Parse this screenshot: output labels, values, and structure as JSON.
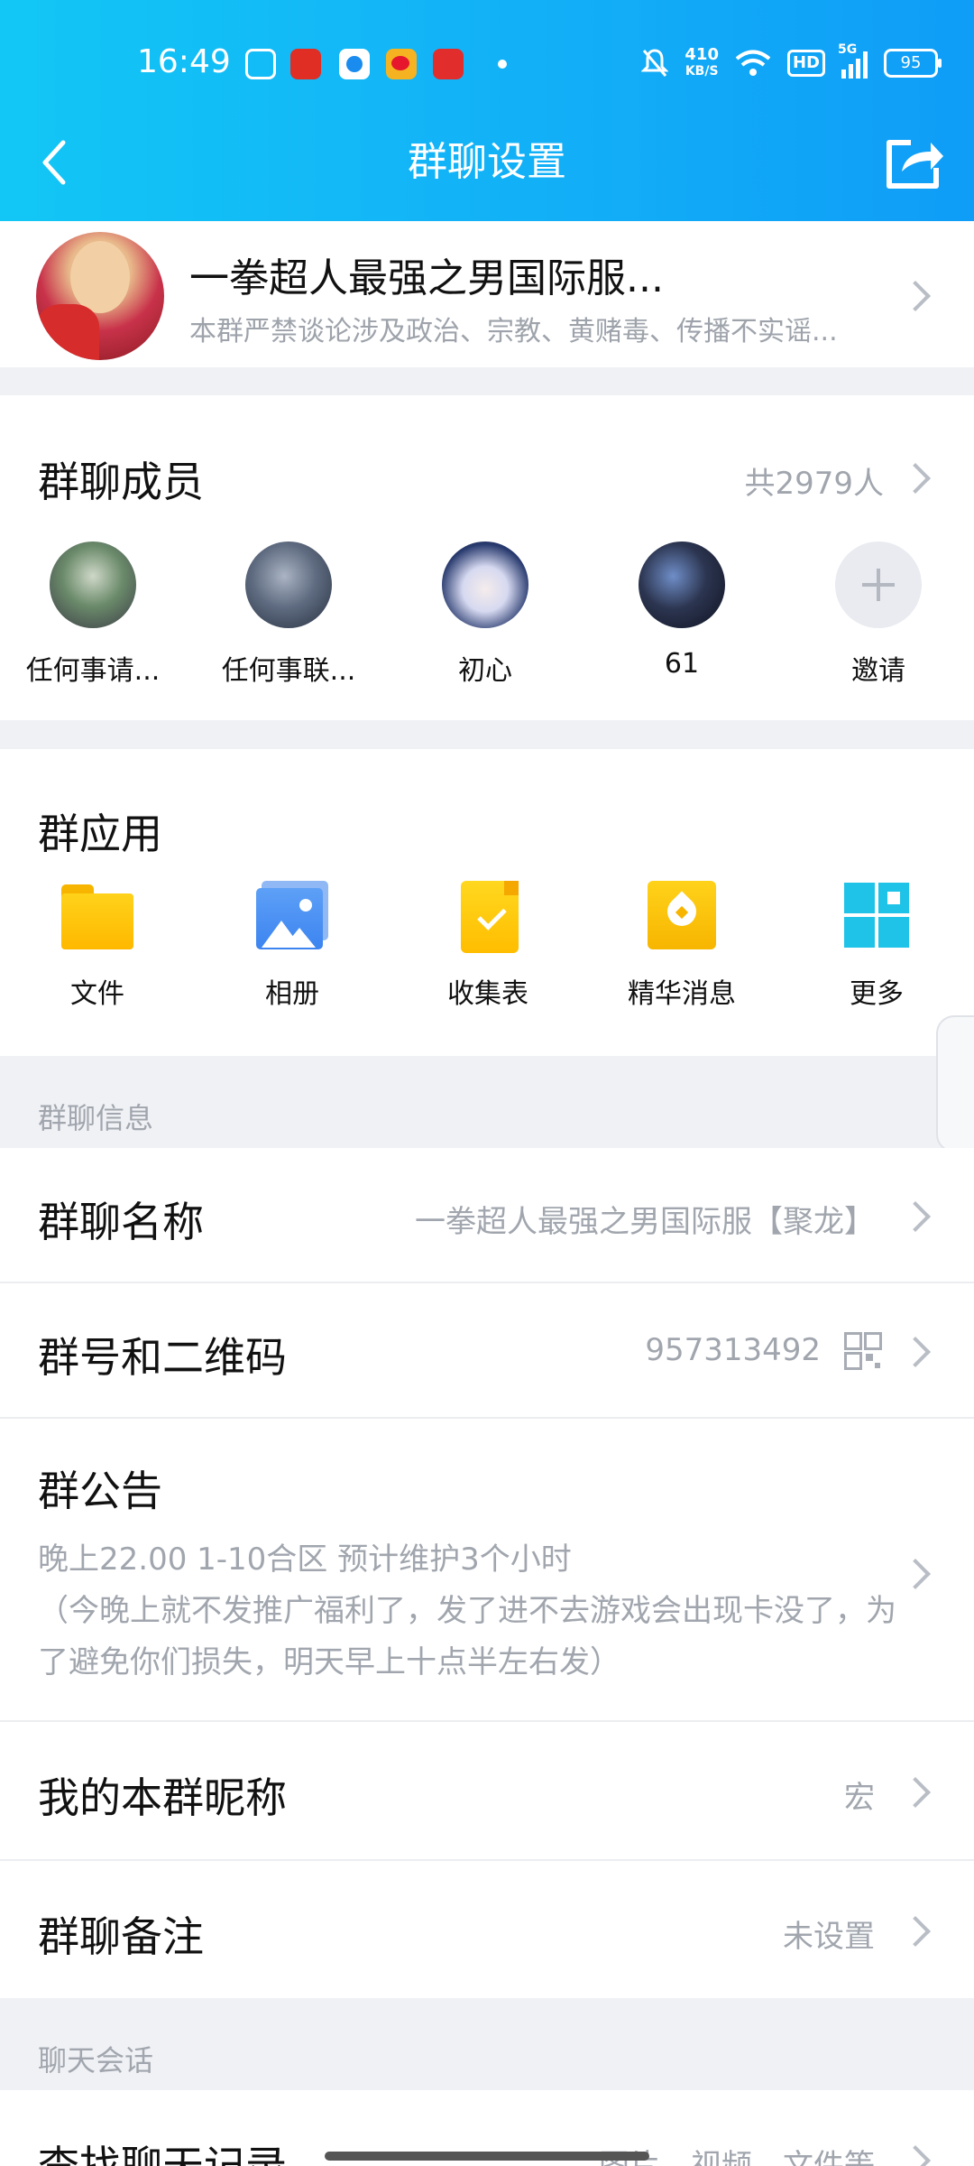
{
  "status_bar": {
    "time": "16:49",
    "net_speed_value": "410",
    "net_speed_unit": "KB/S",
    "network": "5G",
    "hd": "HD",
    "battery": "95",
    "app_icons": [
      "tv-app-icon",
      "pinduoduo-icon",
      "browser-icon",
      "weibo-icon",
      "toutiao-icon"
    ]
  },
  "nav": {
    "title": "群聊设置"
  },
  "group": {
    "name": "一拳超人最强之男国际服...",
    "description": "本群严禁谈论涉及政治、宗教、黄赌毒、传播不实谣..."
  },
  "members": {
    "title": "群聊成员",
    "count": "共2979人",
    "list": [
      {
        "name": "任何事请..."
      },
      {
        "name": "任何事联..."
      },
      {
        "name": "初心"
      },
      {
        "name": "61"
      }
    ],
    "invite_label": "邀请"
  },
  "apps": {
    "title": "群应用",
    "items": [
      {
        "label": "文件",
        "icon": "folder-icon"
      },
      {
        "label": "相册",
        "icon": "album-icon"
      },
      {
        "label": "收集表",
        "icon": "form-icon"
      },
      {
        "label": "精华消息",
        "icon": "essence-icon"
      },
      {
        "label": "更多",
        "icon": "grid-icon"
      }
    ]
  },
  "info": {
    "caption": "群聊信息",
    "name_label": "群聊名称",
    "name_value": "一拳超人最强之男国际服【聚龙】",
    "id_label": "群号和二维码",
    "id_value": "957313492",
    "notice_label": "群公告",
    "notice_line1": "晚上22.00 1-10合区 预计维护3个小时",
    "notice_line2": "（今晚上就不发推广福利了，发了进不去游戏会出现卡没了，为了避免你们损失，明天早上十点半左右发）",
    "nickname_label": "我的本群昵称",
    "nickname_value": "宏",
    "remark_label": "群聊备注",
    "remark_value": "未设置"
  },
  "chat": {
    "caption": "聊天会话",
    "search_label": "查找聊天记录",
    "search_value": "图片、视频、文件等"
  },
  "colors": {
    "header_start": "#12c7f5",
    "header_end": "#0f9df7",
    "muted_text": "#a1a6ae",
    "background": "#f0f1f5"
  }
}
